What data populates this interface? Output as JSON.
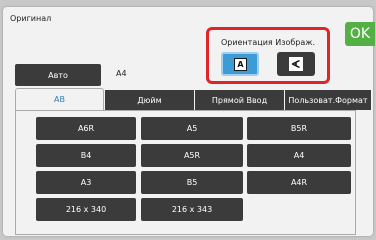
{
  "header": {
    "title": "Оригинал",
    "ok_label": "OK"
  },
  "orientation": {
    "label": "Ориентация Изображ.",
    "portrait_glyph": "A",
    "landscape_glyph": "A",
    "selected": "portrait"
  },
  "auto": {
    "label": "Авто",
    "value": "A4"
  },
  "tabs": [
    {
      "label": "AB",
      "active": true
    },
    {
      "label": "Дюйм",
      "active": false
    },
    {
      "label": "Прямой Ввод",
      "active": false
    },
    {
      "label": "Пользоват.Формат",
      "active": false
    }
  ],
  "sizes": [
    {
      "label": "A6R"
    },
    {
      "label": "A5"
    },
    {
      "label": "B5R"
    },
    {
      "label": "B4"
    },
    {
      "label": "A5R"
    },
    {
      "label": "A4"
    },
    {
      "label": "A3"
    },
    {
      "label": "B5"
    },
    {
      "label": "A4R"
    },
    {
      "label": "216 x 340"
    },
    {
      "label": "216 x 343"
    }
  ],
  "colors": {
    "ok_green": "#54b044",
    "highlight_red": "#e0252a",
    "selected_blue": "#3f9bd6",
    "button_dark": "#3b3b3b",
    "active_tab_text": "#2f80c0"
  }
}
